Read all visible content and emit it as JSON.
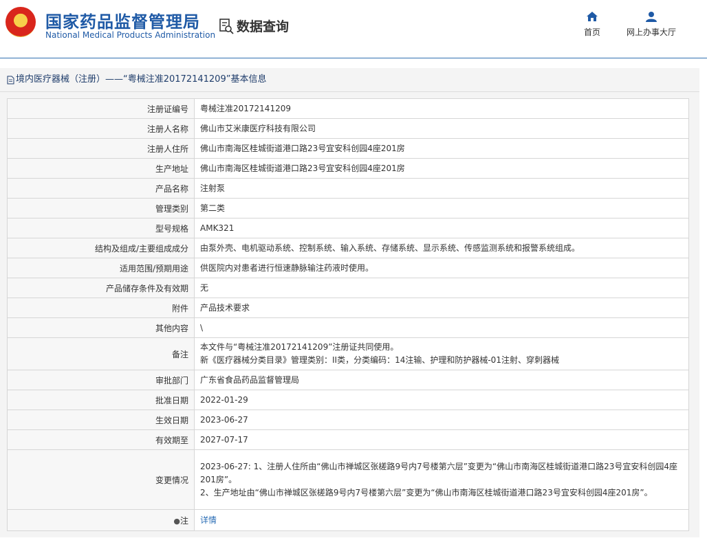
{
  "header": {
    "cn_title": "国家药品监督管理局",
    "en_title": "National Medical Products Administration",
    "query_label": "数据查询",
    "nav": [
      {
        "label": "首页",
        "icon": "home-icon"
      },
      {
        "label": "网上办事大厅",
        "icon": "user-icon"
      }
    ]
  },
  "section": {
    "title": "境内医疗器械（注册）——“粤械注准20172141209”基本信息"
  },
  "rows": {
    "reg_no": {
      "label": "注册证编号",
      "value": "粤械注准20172141209"
    },
    "registrant": {
      "label": "注册人名称",
      "value": "佛山市艾米康医疗科技有限公司"
    },
    "registrant_addr": {
      "label": "注册人住所",
      "value": "佛山市南海区桂城街道港口路23号宜安科创园4座201房"
    },
    "production_addr": {
      "label": "生产地址",
      "value": "佛山市南海区桂城街道港口路23号宜安科创园4座201房"
    },
    "product_name": {
      "label": "产品名称",
      "value": "注射泵"
    },
    "category": {
      "label": "管理类别",
      "value": "第二类"
    },
    "model": {
      "label": "型号规格",
      "value": "AMK321"
    },
    "structure": {
      "label": "结构及组成/主要组成成分",
      "value": "由泵外壳、电机驱动系统、控制系统、输入系统、存储系统、显示系统、传感监测系统和报警系统组成。"
    },
    "scope": {
      "label": "适用范围/预期用途",
      "value": "供医院内对患者进行恒速静脉输注药液时使用。"
    },
    "storage": {
      "label": "产品储存条件及有效期",
      "value": "无"
    },
    "attachment": {
      "label": "附件",
      "value": "产品技术要求"
    },
    "other": {
      "label": "其他内容",
      "value": "\\"
    },
    "remark": {
      "label": "备注",
      "line1": "本文件与“粤械注准20172141209”注册证共同使用。",
      "line2": "新《医疗器械分类目录》管理类别：II类，分类编码：14注输、护理和防护器械-01注射、穿刺器械"
    },
    "approval_dept": {
      "label": "审批部门",
      "value": "广东省食品药品监督管理局"
    },
    "approval_date": {
      "label": "批准日期",
      "value": "2022-01-29"
    },
    "effective_date": {
      "label": "生效日期",
      "value": "2023-06-27"
    },
    "valid_until": {
      "label": "有效期至",
      "value": "2027-07-17"
    },
    "changes": {
      "label": "变更情况",
      "line1": "2023-06-27: 1、注册人住所由“佛山市禅城区张槎路9号内7号楼第六层”变更为“佛山市南海区桂城街道港口路23号宜安科创园4座201房”。",
      "line2": "2、生产地址由“佛山市禅城区张槎路9号内7号楼第六层”变更为“佛山市南海区桂城街道港口路23号宜安科创园4座201房”。"
    },
    "note": {
      "label": "注",
      "pin_icon": "pin-icon",
      "value": "详情"
    }
  }
}
